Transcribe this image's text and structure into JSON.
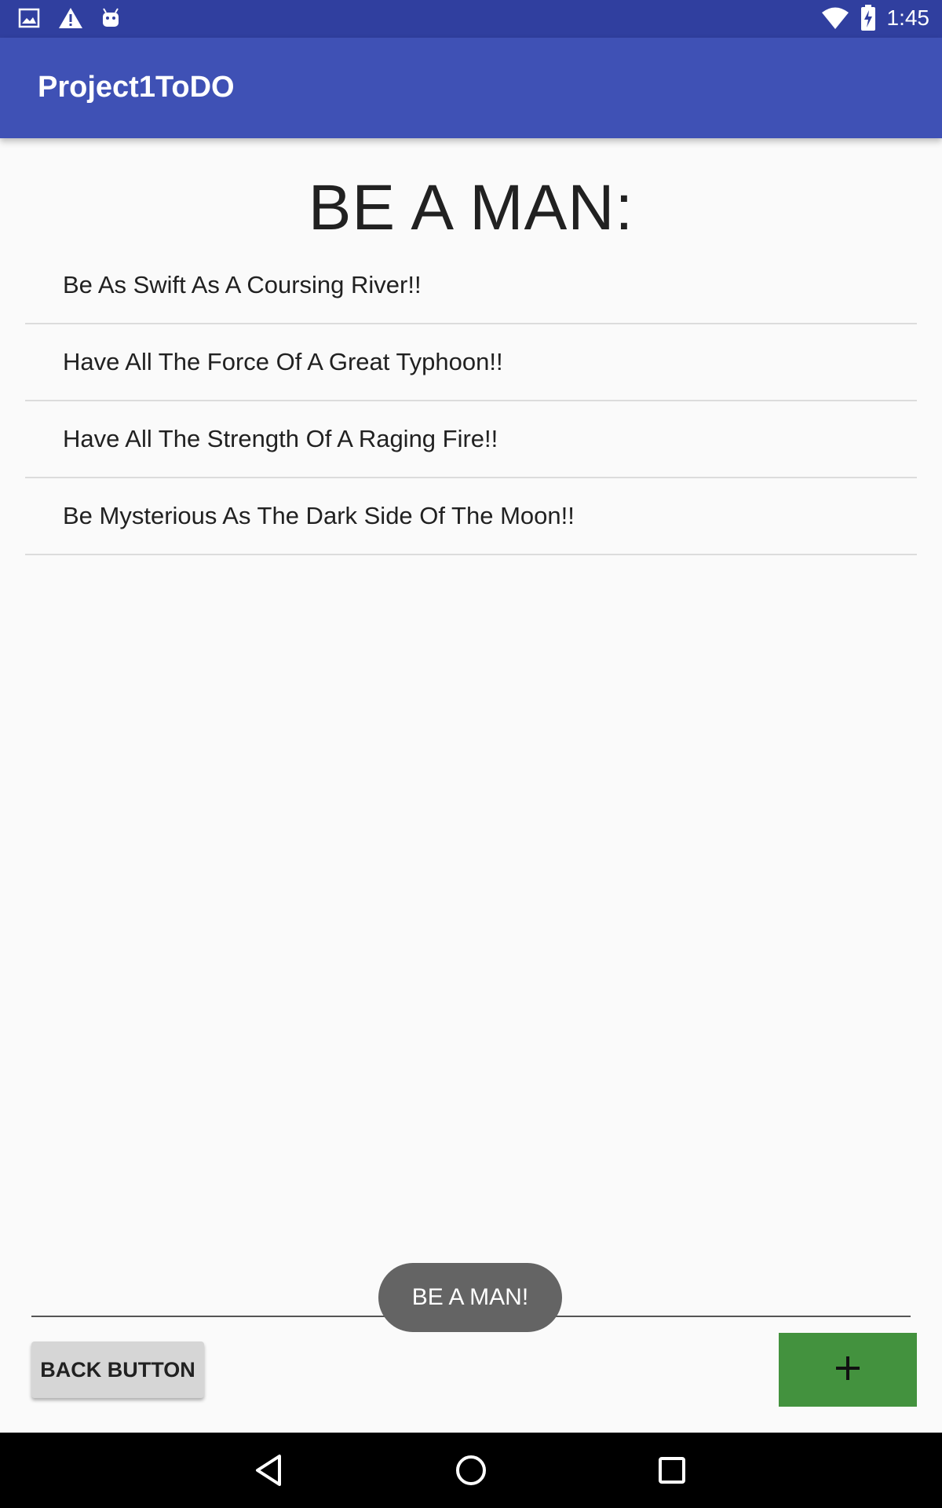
{
  "status_bar": {
    "time": "1:45",
    "left_icons": [
      "image-icon",
      "warning-icon",
      "android-icon"
    ],
    "right_icons": [
      "wifi-icon",
      "battery-charging-icon"
    ]
  },
  "app_bar": {
    "title": "Project1ToDO",
    "color": "#3f51b5"
  },
  "page": {
    "heading": "BE A MAN:"
  },
  "list": {
    "items": [
      {
        "text": "Be As Swift As A Coursing River!!"
      },
      {
        "text": "Have All The Force Of A Great Typhoon!!"
      },
      {
        "text": "Have All The Strength Of A Raging Fire!!"
      },
      {
        "text": "Be Mysterious As The Dark Side Of The Moon!!"
      }
    ]
  },
  "toast": {
    "text": "BE A MAN!"
  },
  "buttons": {
    "back_label": "BACK BUTTON",
    "add_icon": "plus-icon",
    "add_color": "#43923e"
  },
  "nav_bar": {
    "icons": [
      "back-triangle-icon",
      "home-circle-icon",
      "recents-square-icon"
    ]
  }
}
